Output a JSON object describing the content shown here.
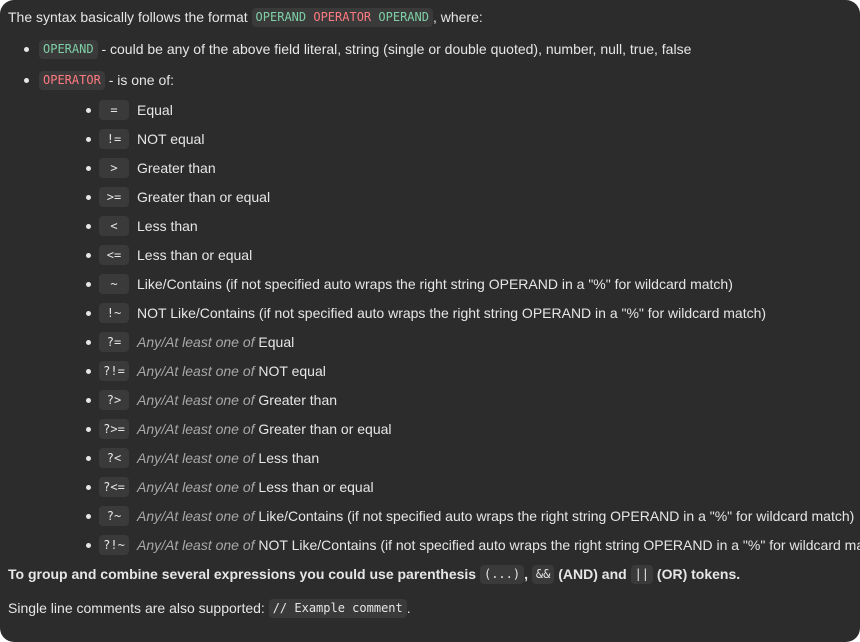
{
  "intro": {
    "prefix": "The syntax basically follows the format",
    "operand1": "OPERAND",
    "operator": "OPERATOR",
    "operand2": "OPERAND",
    "suffix": ", where:"
  },
  "operand_item": {
    "code": "OPERAND",
    "text": "- could be any of the above field literal, string (single or double quoted), number, null, true, false"
  },
  "operator_item": {
    "code": "OPERATOR",
    "text": "- is one of:"
  },
  "any_prefix": "Any/At least one of",
  "operators": [
    {
      "op": "=",
      "desc": "Equal"
    },
    {
      "op": "!=",
      "desc": "NOT equal"
    },
    {
      "op": ">",
      "desc": "Greater than"
    },
    {
      "op": ">=",
      "desc": "Greater than or equal"
    },
    {
      "op": "<",
      "desc": "Less than"
    },
    {
      "op": "<=",
      "desc": "Less than or equal"
    },
    {
      "op": "~",
      "desc": "Like/Contains (if not specified auto wraps the right string OPERAND in a \"%\" for wildcard match)"
    },
    {
      "op": "!~",
      "desc": "NOT Like/Contains (if not specified auto wraps the right string OPERAND in a \"%\" for wildcard match)"
    },
    {
      "op": "?=",
      "desc": "Equal"
    },
    {
      "op": "?!=",
      "desc": "NOT equal"
    },
    {
      "op": "?>",
      "desc": "Greater than"
    },
    {
      "op": "?>=",
      "desc": "Greater than or equal"
    },
    {
      "op": "?<",
      "desc": "Less than"
    },
    {
      "op": "?<=",
      "desc": "Less than or equal"
    },
    {
      "op": "?~",
      "desc": "Like/Contains (if not specified auto wraps the right string OPERAND in a \"%\" for wildcard match)"
    },
    {
      "op": "?!~",
      "desc": "NOT Like/Contains (if not specified auto wraps the right string OPERAND in a \"%\" for wildcard match)"
    }
  ],
  "group": {
    "prefix": "To group and combine several expressions you could use parenthesis",
    "paren": "(...)",
    "sep": ",",
    "and_code": "&&",
    "and_text": "(AND) and",
    "or_code": "||",
    "or_text": "(OR) tokens."
  },
  "comment": {
    "prefix": "Single line comments are also supported:",
    "code": "// Example comment",
    "suffix": "."
  }
}
